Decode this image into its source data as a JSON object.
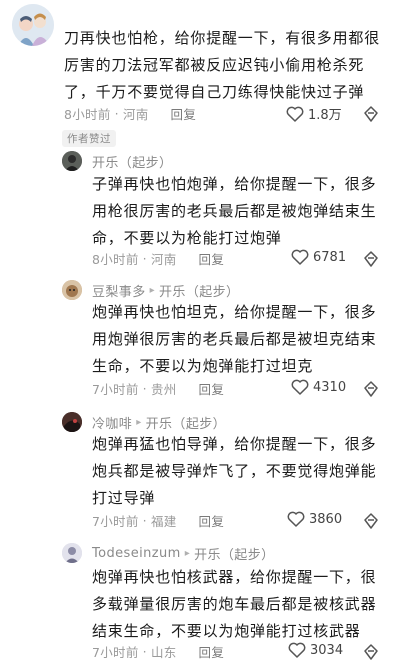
{
  "top_comment": {
    "text": "刀再快也怕枪，给你提醒一下，有很多用都很厉害的刀法冠军都被反应迟钝小偷用枪杀死了，千万不要觉得自己刀练得快能快过子弹",
    "time": "8小时前",
    "location": "河南",
    "reply_label": "回复",
    "likes": "1.8万",
    "author_badge": "作者赞过"
  },
  "replies": [
    {
      "author": "开乐（起步）",
      "reply_to": "",
      "text": "子弹再快也怕炮弹，给你提醒一下，很多用枪很厉害的老兵最后都是被炮弹结束生命，不要以为枪能打过炮弹",
      "time": "8小时前",
      "location": "河南",
      "reply_label": "回复",
      "likes": "6781"
    },
    {
      "author": "豆梨事多",
      "reply_to": "开乐（起步）",
      "text": "炮弹再快也怕坦克，给你提醒一下，很多用炮弹很厉害的老兵最后都是被坦克结束生命，不要以为炮弹能打过坦克",
      "time": "7小时前",
      "location": "贵州",
      "reply_label": "回复",
      "likes": "4310"
    },
    {
      "author": "冷咖啡",
      "reply_to": "开乐（起步）",
      "text": "炮弹再猛也怕导弹，给你提醒一下，很多炮兵都是被导弹炸飞了，不要觉得炮弹能打过导弹",
      "time": "7小时前",
      "location": "福建",
      "reply_label": "回复",
      "likes": "3860"
    },
    {
      "author": "Todeseinzum",
      "reply_to": "开乐（起步）",
      "text": "炮弹再快也怕核武器，给你提醒一下，很多载弹量很厉害的炮车最后都是被核武器结束生命，不要以为炮弹能打过核武器",
      "time": "7小时前",
      "location": "山东",
      "reply_label": "回复",
      "likes": "3034"
    }
  ],
  "reply_arrow": "▸",
  "dot": "·",
  "colors": {
    "text": "#1b1b1b",
    "meta": "#9a9a9a",
    "icon": "#555555"
  }
}
